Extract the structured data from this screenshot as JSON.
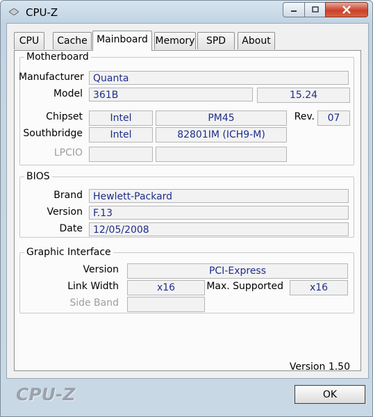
{
  "window": {
    "title": "CPU-Z"
  },
  "tabs": [
    {
      "label": "CPU"
    },
    {
      "label": "Cache"
    },
    {
      "label": "Mainboard"
    },
    {
      "label": "Memory"
    },
    {
      "label": "SPD"
    },
    {
      "label": "About"
    }
  ],
  "motherboard": {
    "legend": "Motherboard",
    "manufacturer_label": "Manufacturer",
    "manufacturer": "Quanta",
    "model_label": "Model",
    "model": "361B",
    "model_rev": "15.24",
    "chipset_label": "Chipset",
    "chipset_vendor": "Intel",
    "chipset_model": "PM45",
    "rev_label": "Rev.",
    "rev": "07",
    "southbridge_label": "Southbridge",
    "southbridge_vendor": "Intel",
    "southbridge_model": "82801IM (ICH9-M)",
    "lpcio_label": "LPCIO",
    "lpcio_vendor": "",
    "lpcio_model": ""
  },
  "bios": {
    "legend": "BIOS",
    "brand_label": "Brand",
    "brand": "Hewlett-Packard",
    "version_label": "Version",
    "version": "F.13",
    "date_label": "Date",
    "date": "12/05/2008"
  },
  "graphic": {
    "legend": "Graphic Interface",
    "version_label": "Version",
    "version": "PCI-Express",
    "link_width_label": "Link Width",
    "link_width": "x16",
    "max_supported_label": "Max. Supported",
    "max_supported": "x16",
    "side_band_label": "Side Band",
    "side_band": ""
  },
  "footer": {
    "version": "Version 1.50",
    "brand": "CPU-Z",
    "ok_label": "OK"
  }
}
